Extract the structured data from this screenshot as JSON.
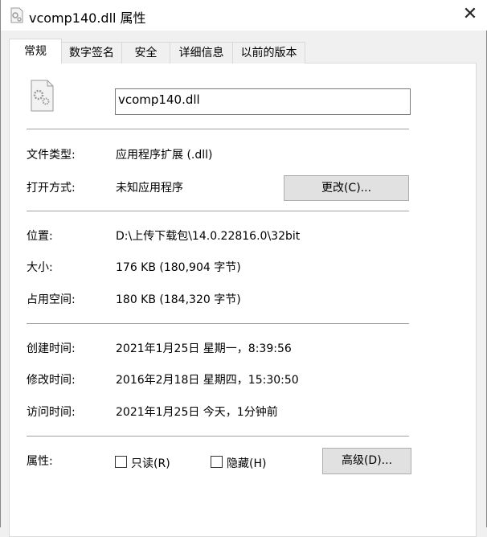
{
  "window": {
    "title": "vcomp140.dll 属性",
    "close": "✕"
  },
  "tabs": [
    {
      "label": "常规"
    },
    {
      "label": "数字签名"
    },
    {
      "label": "安全"
    },
    {
      "label": "详细信息"
    },
    {
      "label": "以前的版本"
    }
  ],
  "general": {
    "file_name": "vcomp140.dll",
    "rows": [
      {
        "label": "文件类型:",
        "value": "应用程序扩展 (.dll)"
      },
      {
        "label": "打开方式:",
        "value": "未知应用程序"
      },
      {
        "label": "位置:",
        "value": "D:\\上传下载包\\14.0.22816.0\\32bit"
      },
      {
        "label": "大小:",
        "value": "176 KB (180,904 字节)"
      },
      {
        "label": "占用空间:",
        "value": "180 KB (184,320 字节)"
      },
      {
        "label": "创建时间:",
        "value": "2021年1月25日 星期一，8:39:56"
      },
      {
        "label": "修改时间:",
        "value": "2016年2月18日 星期四，15:30:50"
      },
      {
        "label": "访问时间:",
        "value": "2021年1月25日 今天，1分钟前"
      }
    ],
    "change_button": "更改(C)...",
    "attributes_label": "属性:",
    "readonly": {
      "label": "只读(R)",
      "checked": false
    },
    "hidden": {
      "label": "隐藏(H)",
      "checked": false
    },
    "advanced_button": "高级(D)..."
  }
}
